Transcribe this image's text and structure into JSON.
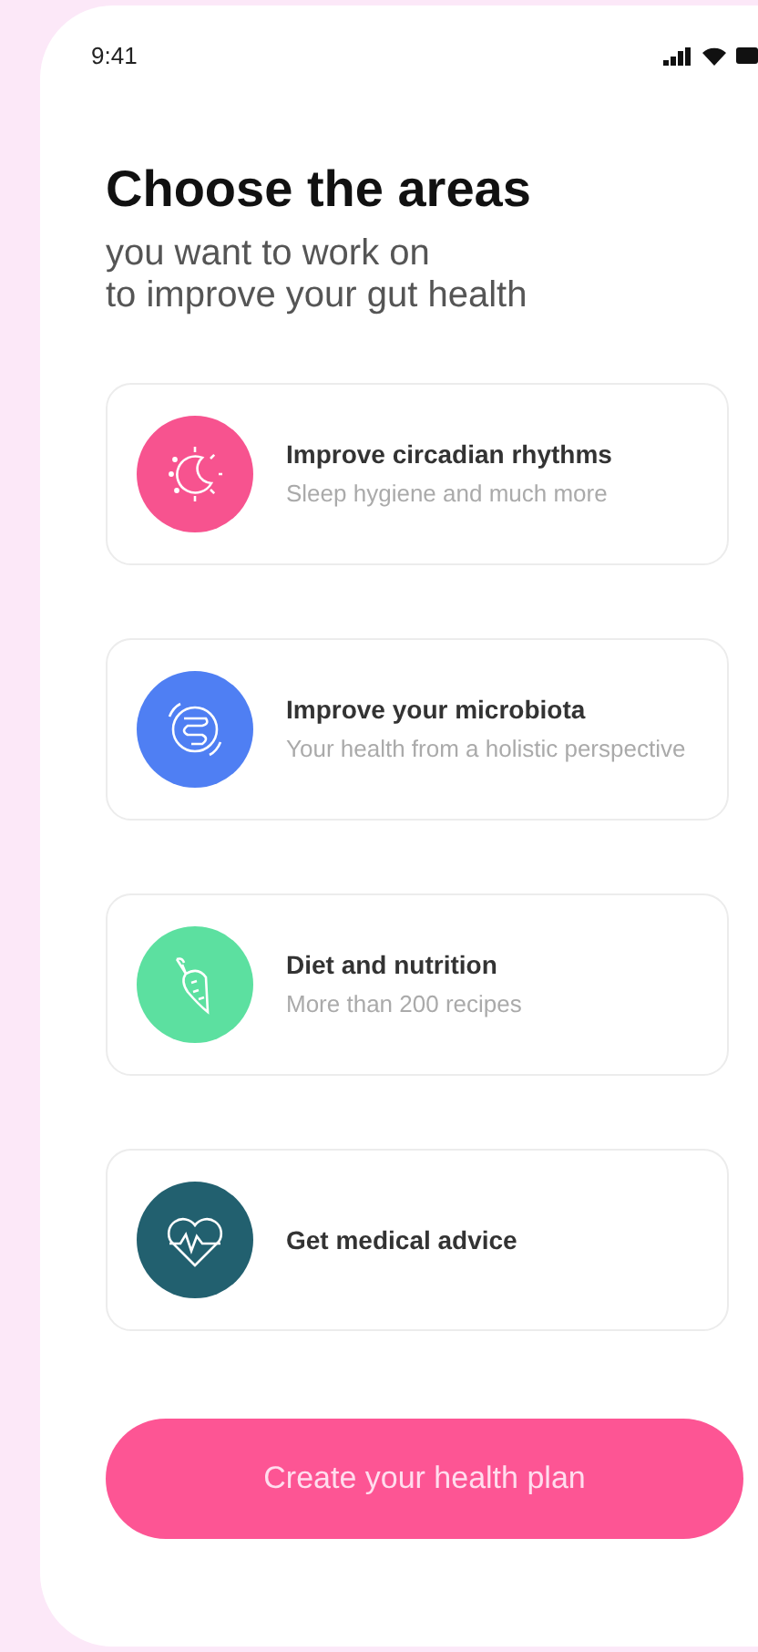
{
  "status_bar": {
    "time": "9:41"
  },
  "heading": {
    "title": "Choose the areas",
    "subtitle_lines": [
      "you want to work on",
      "to improve your gut health"
    ]
  },
  "areas": [
    {
      "kind": "moon",
      "color": "#f7538f",
      "title": "Improve circadian rhythms",
      "subtitle": "Sleep hygiene and much more"
    },
    {
      "kind": "gut",
      "color": "#4f7ff3",
      "title": "Improve your microbiota",
      "subtitle": "Your health from a holistic perspective"
    },
    {
      "kind": "carrot",
      "color": "#5ce0a0",
      "title": "Diet and nutrition",
      "subtitle": "More than 200 recipes"
    },
    {
      "kind": "heart",
      "color": "#22606f",
      "title": "Get medical advice"
    }
  ],
  "button": {
    "label": "Create your health plan"
  }
}
